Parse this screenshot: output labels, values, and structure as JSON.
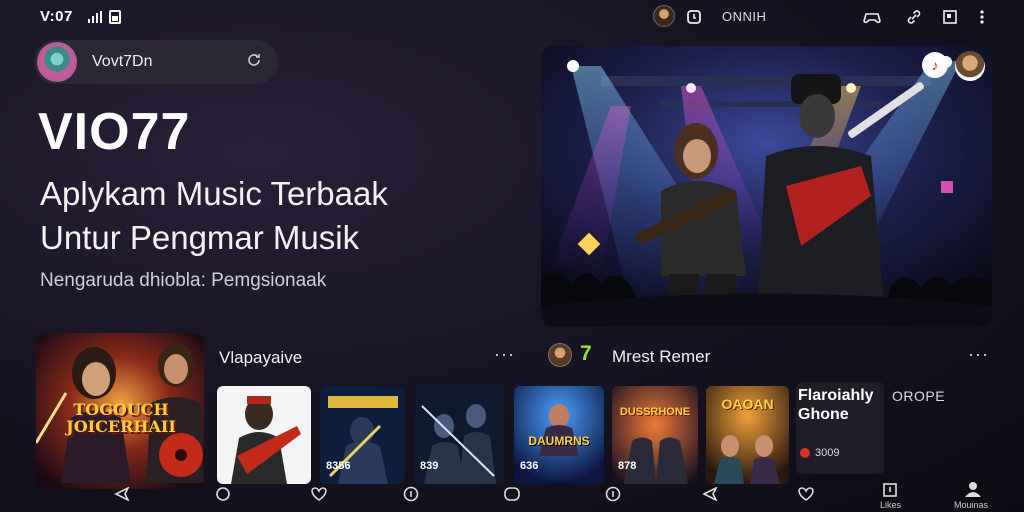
{
  "status_bar": {
    "time": "V:07",
    "center_label": "ONNIH",
    "icons": [
      "signal-icon",
      "battery-icon",
      "avatar",
      "alarm-icon",
      "gamepad-icon",
      "link-icon",
      "square-icon",
      "more-icon"
    ]
  },
  "search": {
    "user": "Vovt7Dn"
  },
  "header": {
    "title": "VIO77",
    "tagline_line1": "Aplykam Music Terbaak",
    "tagline_line2": "Untur Pengmar Musik",
    "subtitle": "Nengaruda dhiobla: Pemgsionaak"
  },
  "hero": {
    "actions": [
      "music-note-icon",
      "profile-avatar"
    ]
  },
  "sections": {
    "left_title": "Vlapayaive",
    "right_title": "Mrest Remer",
    "right_badge": "7",
    "more": "···"
  },
  "featured": {
    "title": "TOGOUCH JOICERHAII"
  },
  "thumbnails": [
    {
      "label": ""
    },
    {
      "label": "8356"
    },
    {
      "label": "839"
    },
    {
      "label": "636"
    },
    {
      "label": "878"
    },
    {
      "label": ""
    }
  ],
  "thumb_titles": [
    "",
    "",
    "",
    "DAUMRNS",
    "DUSSRHONE",
    "OAOAN"
  ],
  "info_card": {
    "title": "Flaroiahl<br>Ghone",
    "title_line1": "Flaroiahly",
    "title_line2": "Ghone",
    "count": "3009"
  },
  "side_label": "OROPE",
  "bottom_nav": {
    "labels": [
      "",
      "",
      "",
      "",
      "",
      "",
      "",
      "",
      "Likes",
      "Mouinas"
    ]
  },
  "colors": {
    "background": "#171424",
    "card": "#2b2735",
    "accent": "#e0b83a",
    "badge_red": "#d9302a",
    "badge_green": "#9be02c"
  }
}
